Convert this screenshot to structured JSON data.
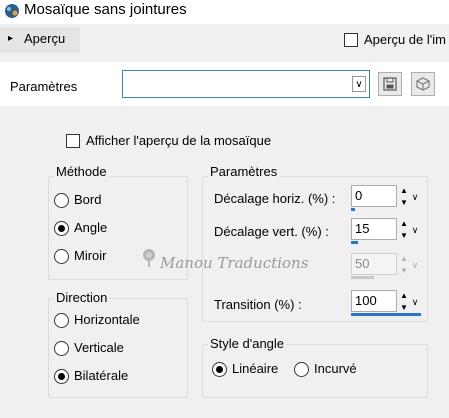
{
  "window": {
    "title": "Mosaïque sans jointures"
  },
  "preview": {
    "toggle_label": "Aperçu",
    "apercu_image_label": "Aperçu de l'im"
  },
  "presets": {
    "label": "Paramètres",
    "selected": ""
  },
  "options": {
    "show_preview_label": "Afficher l'aperçu de la mosaïque"
  },
  "methode": {
    "title": "Méthode",
    "items": [
      {
        "label": "Bord",
        "checked": false
      },
      {
        "label": "Angle",
        "checked": true
      },
      {
        "label": "Miroir",
        "checked": false
      }
    ]
  },
  "direction": {
    "title": "Direction",
    "items": [
      {
        "label": "Horizontale",
        "checked": false
      },
      {
        "label": "Verticale",
        "checked": false
      },
      {
        "label": "Bilatérale",
        "checked": true
      }
    ]
  },
  "parametres": {
    "title": "Paramètres",
    "fields": [
      {
        "label": "Décalage horiz. (%) :",
        "value": "0",
        "level": 0
      },
      {
        "label": "Décalage vert. (%) :",
        "value": "15",
        "level": 0.15
      },
      {
        "label": "",
        "value": "50",
        "level": 0.5,
        "disabled": true
      },
      {
        "label": "Transition (%) :",
        "value": "100",
        "level": 1.0
      }
    ]
  },
  "style_angle": {
    "title": "Style d'angle",
    "items": [
      {
        "label": "Linéaire",
        "checked": true
      },
      {
        "label": "Incurvé",
        "checked": false
      }
    ]
  },
  "watermark": {
    "text": "Manou Traductions"
  },
  "icons": {
    "app": "mosaic-app-icon",
    "save": "floppy-save-icon",
    "reset": "reset-cube-icon",
    "dropdown": "chevron-down-icon",
    "spinner_up": "triangle-up-icon",
    "spinner_down": "triangle-down-icon"
  },
  "colors": {
    "accent": "#2a78c4",
    "dropdown_border": "#3c7fb1"
  }
}
